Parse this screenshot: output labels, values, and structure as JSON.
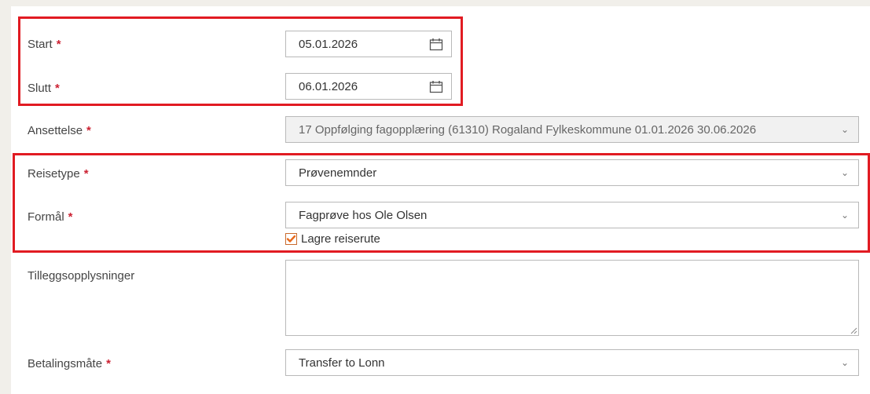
{
  "form": {
    "start": {
      "label": "Start",
      "required_mark": "*",
      "value": "05.01.2026",
      "icon": "calendar-icon"
    },
    "slutt": {
      "label": "Slutt",
      "required_mark": "*",
      "value": "06.01.2026",
      "icon": "calendar-icon"
    },
    "ansettelse": {
      "label": "Ansettelse",
      "required_mark": "*",
      "value": "17 Oppfølging fagopplæring (61310) Rogaland Fylkeskommune 01.01.2026 30.06.2026",
      "disabled": true
    },
    "reisetype": {
      "label": "Reisetype",
      "required_mark": "*",
      "value": "Prøvenemnder"
    },
    "formal": {
      "label": "Formål",
      "required_mark": "*",
      "value": "Fagprøve hos Ole Olsen"
    },
    "lagre_reiserute": {
      "label": "Lagre reiserute",
      "checked": true
    },
    "tillegg": {
      "label": "Tilleggsopplysninger",
      "value": ""
    },
    "betaling": {
      "label": "Betalingsmåte",
      "required_mark": "*",
      "value": "Transfer to Lonn"
    },
    "chevron_icon": "chevron-down-icon"
  },
  "colors": {
    "highlight": "#e11b22",
    "required": "#cc2233",
    "checkbox_accent": "#e86a1c",
    "page_bg": "#f1efea"
  }
}
